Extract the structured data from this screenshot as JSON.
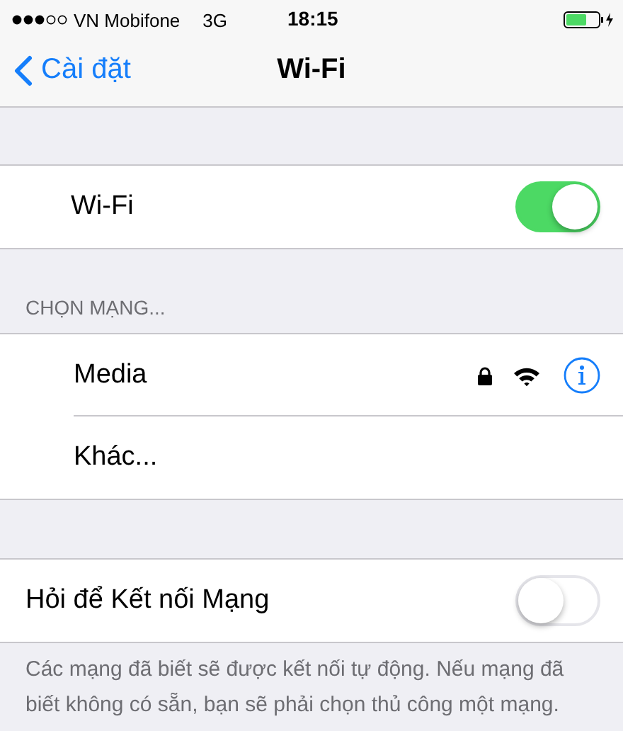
{
  "status_bar": {
    "carrier": "VN Mobifone",
    "network": "3G",
    "time": "18:15"
  },
  "nav": {
    "back": "Cài đặt",
    "title": "Wi-Fi"
  },
  "wifi": {
    "label": "Wi-Fi",
    "on": true
  },
  "networks_header": "CHỌN MẠNG...",
  "networks": [
    {
      "kind": "network",
      "name": "Media",
      "locked": true
    },
    {
      "kind": "other",
      "name": "Khác..."
    }
  ],
  "ask": {
    "label": "Hỏi để Kết nối Mạng",
    "on": false
  },
  "footer": "Các mạng đã biết sẽ được kết nối tự động. Nếu mạng đã biết không có sẵn, bạn sẽ phải chọn thủ công một mạng."
}
